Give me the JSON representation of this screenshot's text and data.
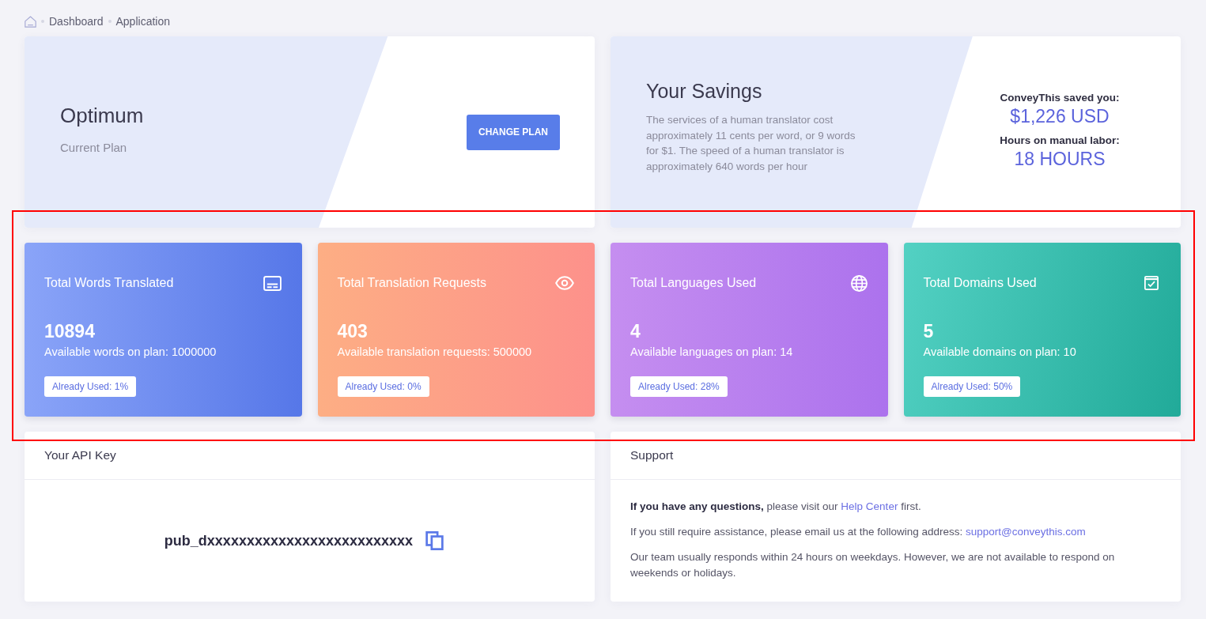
{
  "breadcrumb": [
    "Dashboard",
    "Application"
  ],
  "plan": {
    "name": "Optimum",
    "caption": "Current Plan",
    "button": "CHANGE PLAN"
  },
  "savings": {
    "title": "Your Savings",
    "description": "The services of a human translator cost approximately 11 cents per word, or 9 words for $1. The speed of a human translator is approximately 640 words per hour",
    "stats": [
      {
        "label": "ConveyThis saved you:",
        "value": "$1,226 USD"
      },
      {
        "label": "Hours on manual labor:",
        "value": "18 HOURS"
      }
    ]
  },
  "stats": [
    {
      "kind": "words",
      "title": "Total Words Translated",
      "value": "10894",
      "available": "Available words on plan: 1000000",
      "badge": "Already Used: 1%"
    },
    {
      "kind": "requests",
      "title": "Total Translation Requests",
      "value": "403",
      "available": "Available translation requests: 500000",
      "badge": "Already Used: 0%"
    },
    {
      "kind": "languages",
      "title": "Total Languages Used",
      "value": "4",
      "available": "Available languages on plan: 14",
      "badge": "Already Used: 28%"
    },
    {
      "kind": "domains",
      "title": "Total Domains Used",
      "value": "5",
      "available": "Available domains on plan: 10",
      "badge": "Already Used: 50%"
    }
  ],
  "api_key": {
    "title": "Your API Key",
    "key": "pub_dxxxxxxxxxxxxxxxxxxxxxxxxxx"
  },
  "support": {
    "title": "Support",
    "paragraphs": [
      {
        "text": "**If you have any questions,** please visit our ",
        "link": "Help Center",
        "after": " first."
      },
      {
        "text": "If you still require assistance, please email us at the following address: ",
        "link": "support@conveythis.com"
      },
      {
        "text": "Our team usually responds within 24 hours on weekdays. However, we are not available to respond on weekends or holidays."
      }
    ]
  }
}
